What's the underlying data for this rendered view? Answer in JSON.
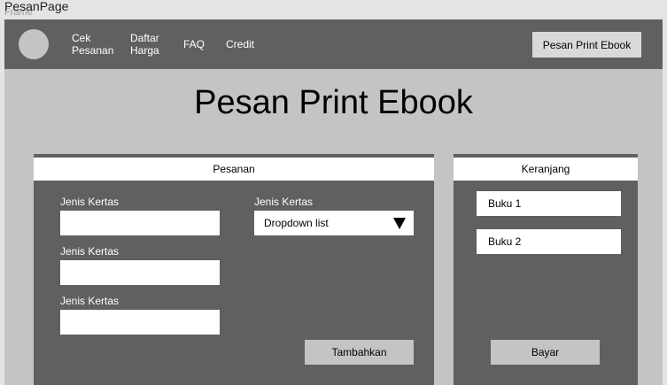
{
  "page": {
    "name": "PesanPage",
    "frame_label": "Frame"
  },
  "nav": {
    "items": [
      {
        "label_line1": "Cek",
        "label_line2": "Pesanan"
      },
      {
        "label_line1": "Daftar",
        "label_line2": "Harga"
      },
      {
        "label": "FAQ"
      },
      {
        "label": "Credit"
      }
    ],
    "cta_label": "Pesan Print Ebook"
  },
  "main": {
    "title": "Pesan Print Ebook"
  },
  "pesanan": {
    "header": "Pesanan",
    "fields": [
      {
        "label": "Jenis Kertas",
        "value": ""
      },
      {
        "label": "Jenis Kertas",
        "value": ""
      },
      {
        "label": "Jenis Kertas",
        "value": ""
      }
    ],
    "dropdown": {
      "label": "Jenis Kertas",
      "selected": "Dropdown list",
      "icon": "triangle-down-icon"
    },
    "submit_label": "Tambahkan"
  },
  "keranjang": {
    "header": "Keranjang",
    "items": [
      {
        "label": "Buku 1"
      },
      {
        "label": "Buku 2"
      }
    ],
    "pay_label": "Bayar"
  },
  "colors": {
    "nav_bg": "#606060",
    "frame_bg": "#c4c4c4",
    "panel_bg": "#606060",
    "button_bg": "#c4c4c4",
    "canvas_bg": "#e4e4e4"
  }
}
